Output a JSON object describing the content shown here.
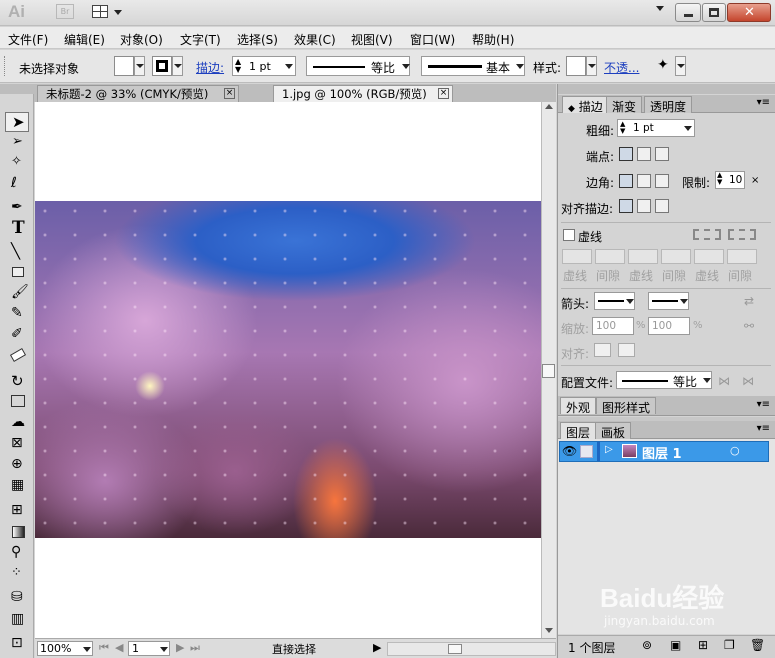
{
  "titlebar": {
    "logo": "Ai",
    "br": "Br"
  },
  "menu": [
    "文件(F)",
    "编辑(E)",
    "对象(O)",
    "文字(T)",
    "选择(S)",
    "效果(C)",
    "视图(V)",
    "窗口(W)",
    "帮助(H)"
  ],
  "control": {
    "no_selection": "未选择对象",
    "stroke_label": "描边:",
    "stroke_weight": "1 pt",
    "profile": "等比",
    "brush": "基本",
    "style_label": "样式:",
    "opacity_label": "不透..."
  },
  "tabs": [
    {
      "label": "未标题-2 @ 33% (CMYK/预览)",
      "close": "×"
    },
    {
      "label": "1.jpg @ 100% (RGB/预览)",
      "close": "×"
    }
  ],
  "status": {
    "zoom": "100%",
    "page": "1",
    "tool": "直接选择"
  },
  "stroke_panel": {
    "tabs": [
      "描边",
      "渐变",
      "透明度"
    ],
    "weight_label": "粗细:",
    "weight_value": "1 pt",
    "cap_label": "端点:",
    "join_label": "边角:",
    "limit_label": "限制:",
    "limit_value": "10",
    "align_label": "对齐描边:",
    "dashed_label": "虚线",
    "dash_labels": [
      "虚线",
      "间隙",
      "虚线",
      "间隙",
      "虚线",
      "间隙"
    ],
    "arrow_label": "箭头:",
    "scale_label": "缩放:",
    "scale_1": "100",
    "scale_2": "100",
    "percent": "%",
    "align2_label": "对齐:",
    "profile_label": "配置文件:",
    "profile_value": "等比"
  },
  "appearance_panel": {
    "tabs": [
      "外观",
      "图形样式"
    ]
  },
  "layers_panel": {
    "tabs": [
      "图层",
      "画板"
    ],
    "layer_name": "图层 1",
    "footer": "1 个图层"
  },
  "watermark": {
    "brand": "Baidu经验",
    "url": "jingyan.baidu.com"
  },
  "colors": {
    "accent": "#3b99e8",
    "link": "#0000ee"
  }
}
